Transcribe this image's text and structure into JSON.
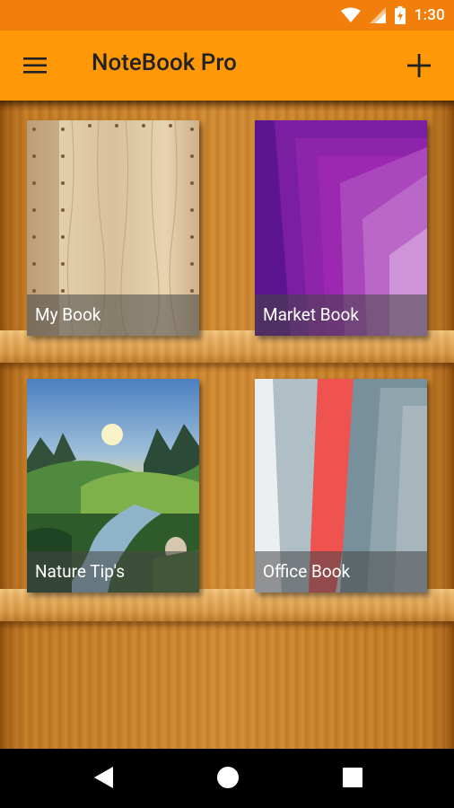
{
  "status_bar": {
    "time": "1:30",
    "icons": [
      "wifi-icon",
      "cellular-signal-icon",
      "battery-charging-icon"
    ]
  },
  "app_bar": {
    "title": "NoteBook Pro",
    "menu_icon": "hamburger-menu-icon",
    "add_icon": "plus-icon"
  },
  "books": [
    {
      "title": "My Book",
      "cover": "wood-cover"
    },
    {
      "title": "Market Book",
      "cover": "purple-geometric-cover"
    },
    {
      "title": "Nature Tip's",
      "cover": "landscape-painting-cover"
    },
    {
      "title": "Office Book",
      "cover": "grey-red-geometric-cover"
    }
  ],
  "nav_bar": {
    "back_icon": "back-triangle-icon",
    "home_icon": "home-circle-icon",
    "recents_icon": "recents-square-icon"
  },
  "colors": {
    "status_bar": "#f27f0c",
    "app_bar": "#ff9807",
    "shelf_wood": "#d28c33"
  }
}
